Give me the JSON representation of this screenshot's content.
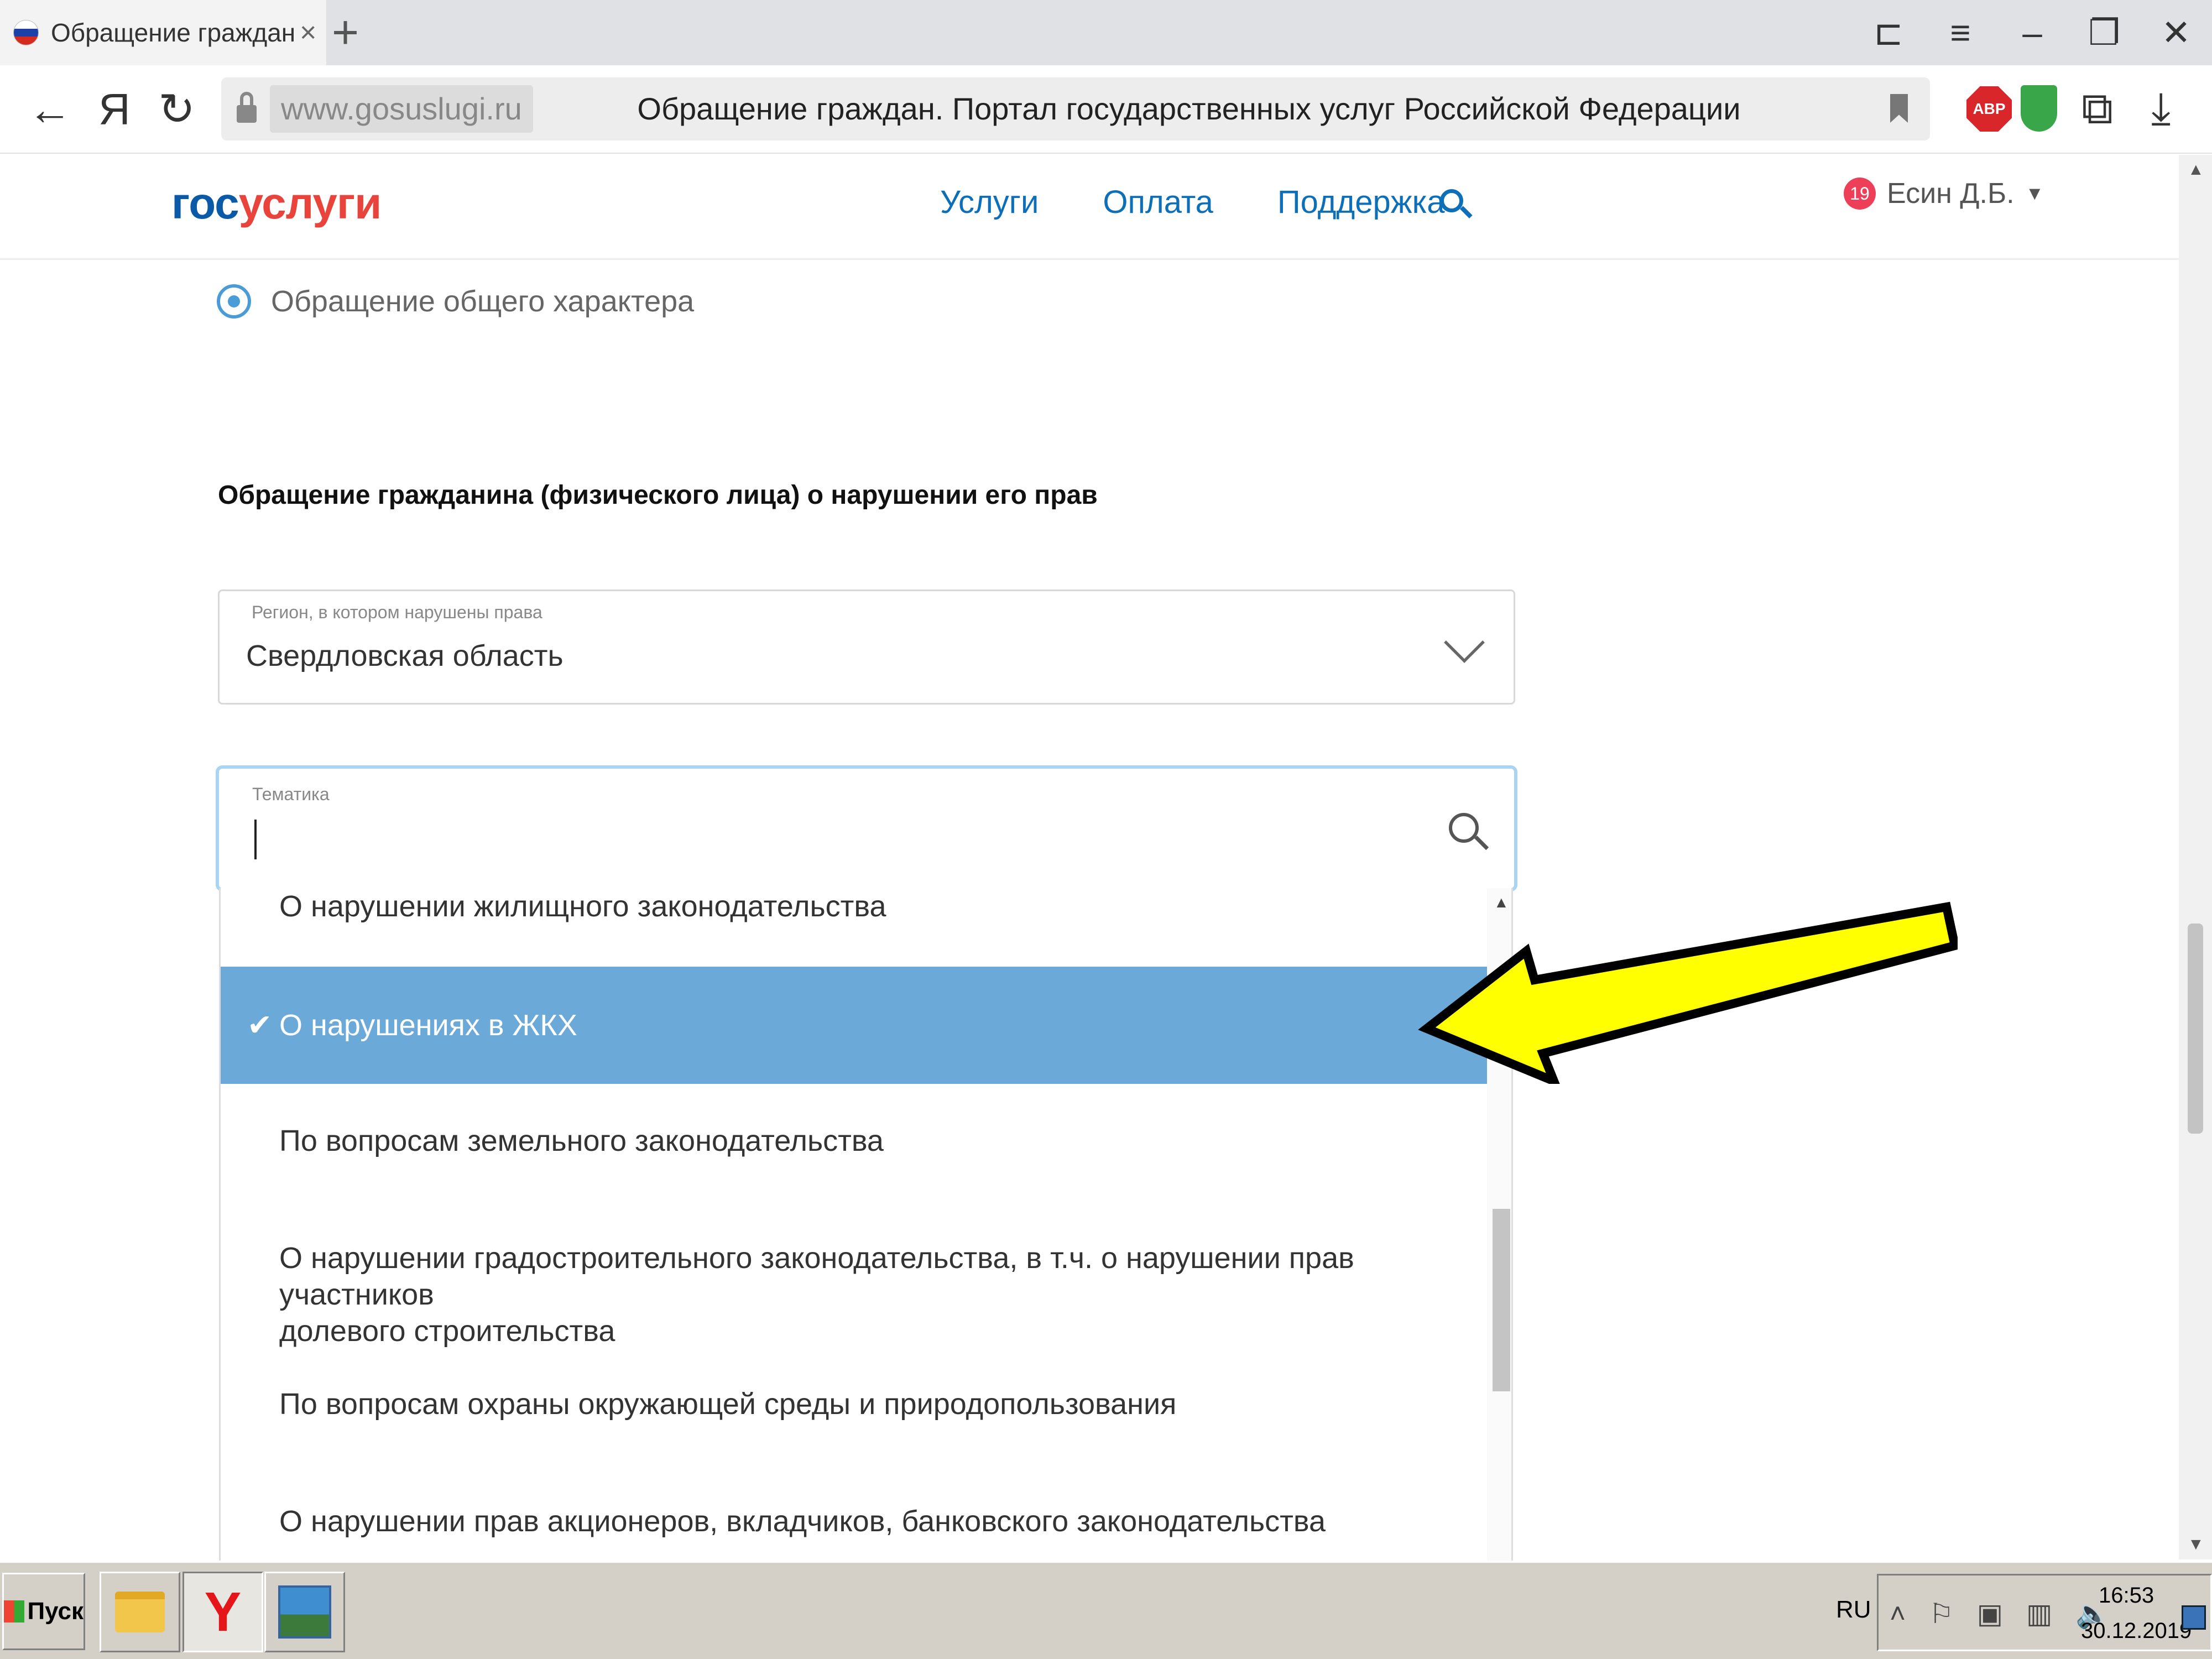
{
  "browser": {
    "tab_title": "Обращение граждан. Пор",
    "tab_close": "×",
    "new_tab": "+",
    "window_controls": [
      "⊏",
      "≡",
      "–",
      "❐",
      "✕"
    ],
    "nav": {
      "back": "←",
      "yandex": "Я",
      "reload": "↻"
    },
    "url": "www.gosuslugi.ru",
    "page_title": "Обращение граждан. Портал государственных услуг Российской Федерации",
    "extensions": {
      "abp": "ABP"
    },
    "icons": [
      "lock-icon",
      "bookmark-icon",
      "adblock-icon",
      "shield-icon",
      "extension-icon",
      "download-icon"
    ]
  },
  "site": {
    "logo_part1": "гос",
    "logo_part2": "услуги",
    "nav": [
      "Услуги",
      "Оплата",
      "Поддержка"
    ],
    "notifications_count": "19",
    "user_name": "Есин Д.Б.",
    "user_caret": "▼"
  },
  "form": {
    "radio_label": "Обращение общего характера",
    "section_title": "Обращение гражданина (физического лица) о нарушении его прав",
    "region": {
      "label": "Регион, в котором нарушены права",
      "value": "Свердловская область"
    },
    "theme": {
      "label": "Тематика",
      "value": "",
      "placeholder": ""
    },
    "dropdown_items": [
      {
        "label": "О нарушении жилищного законодательства",
        "selected": false
      },
      {
        "label": "О нарушениях в ЖКХ",
        "selected": true
      },
      {
        "label": "По вопросам земельного законодательства",
        "selected": false
      },
      {
        "label": "О нарушении градостроительного законодательства, в т.ч. о нарушении прав участников",
        "label_line2": "долевого строительства",
        "selected": false
      },
      {
        "label": "По вопросам охраны окружающей среды и природопользования",
        "selected": false
      },
      {
        "label": "О нарушении прав акционеров, вкладчиков, банковского законодательства",
        "selected": false
      }
    ],
    "check_mark": "✔"
  },
  "taskbar": {
    "start_label": "Пуск",
    "yandex_letter": "Y",
    "language": "RU",
    "tray_icons": "˄ ⚐ ▣ ▥ 🔈",
    "time": "16:53",
    "date": "30.12.2019"
  },
  "colors": {
    "accent": "#0d6fb8",
    "selected_row": "#6aa9d8",
    "annotation_arrow": "#ffff00",
    "notification_badge": "#ee3f58"
  }
}
